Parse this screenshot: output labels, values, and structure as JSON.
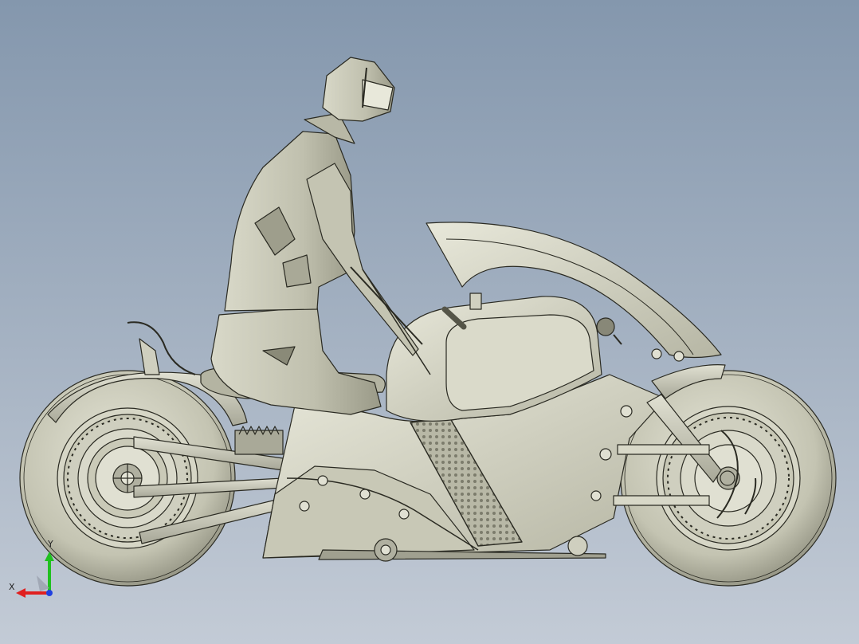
{
  "viewport": {
    "model": "motorcycle-with-rider",
    "view": "side",
    "background_top": "#8497ad",
    "background_bottom": "#c3cbd6"
  },
  "triad": {
    "x_label": "X",
    "y_label": "Y",
    "x_color": "#e02020",
    "y_color": "#20c020",
    "z_color": "#2040e0"
  }
}
